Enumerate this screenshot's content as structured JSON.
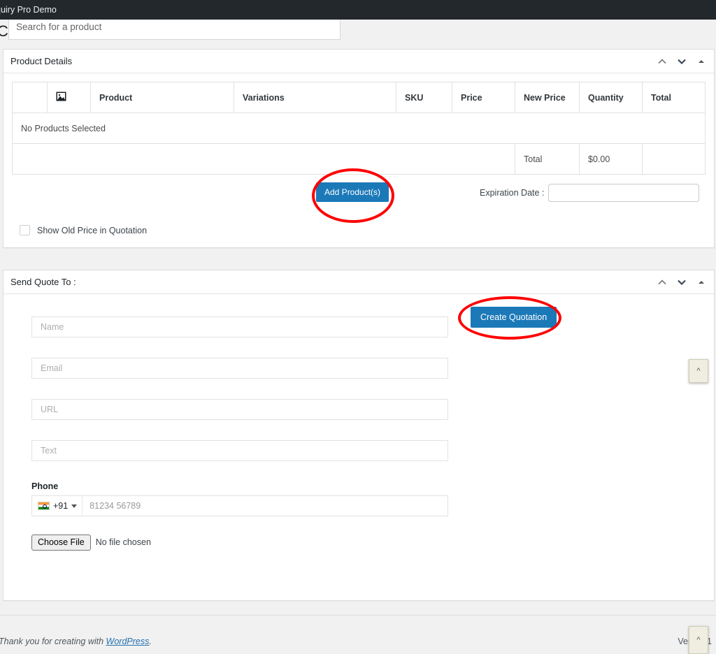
{
  "adminbar": {
    "site_title": "quiry Pro Demo"
  },
  "page": {
    "title": "Create Quotation"
  },
  "product_panel": {
    "title": "Product Details",
    "controls": [
      {
        "name": "move-up-icon",
        "label": "Move up"
      },
      {
        "name": "move-down-icon",
        "label": "Move down"
      },
      {
        "name": "toggle-panel-icon",
        "label": "Toggle panel"
      }
    ],
    "table": {
      "headers": [
        "",
        "image-icon",
        "Product",
        "Variations",
        "SKU",
        "Price",
        "New Price",
        "Quantity",
        "Total"
      ],
      "empty_message": "No Products Selected",
      "totals_label": "Total",
      "totals_value": "$0.00"
    },
    "search": {
      "placeholder": "Search for a product",
      "value": ""
    },
    "add_products_label": "Add Product(s)",
    "expiration": {
      "label": "Expiration Date :",
      "value": "",
      "placeholder": ""
    },
    "show_old_price_label": "Show Old Price in Quotation",
    "show_old_price_checked": false
  },
  "quote_panel": {
    "title": "Send Quote To :",
    "controls": [
      {
        "name": "move-up-icon",
        "label": "Move up"
      },
      {
        "name": "move-down-icon",
        "label": "Move down"
      },
      {
        "name": "toggle-panel-icon",
        "label": "Toggle panel"
      }
    ],
    "create_quotation_label": "Create Quotation",
    "fields": [
      {
        "name": "name",
        "placeholder": "Name",
        "value": ""
      },
      {
        "name": "email",
        "placeholder": "Email",
        "value": ""
      },
      {
        "name": "url",
        "placeholder": "URL",
        "value": ""
      },
      {
        "name": "text",
        "placeholder": "Text",
        "value": ""
      }
    ],
    "phone": {
      "label": "Phone",
      "flag": "india-flag-icon",
      "country_code": "+91",
      "placeholder": "81234 56789",
      "value": ""
    },
    "file": {
      "button_label": "Choose File",
      "status": "No file chosen"
    }
  },
  "footer": {
    "credit_prefix": "Thank you for creating with ",
    "credit_link": "WordPress",
    "credit_suffix": ".",
    "version": "Versio      .1"
  },
  "floating": {
    "scroll_mid_label": "^",
    "scroll_foot_label": "^"
  },
  "colors": {
    "accent_blue": "#1b79b8",
    "annotation_red": "#fe0000",
    "adminbar_bg": "#23282d",
    "page_bg": "#f1f1f1"
  }
}
